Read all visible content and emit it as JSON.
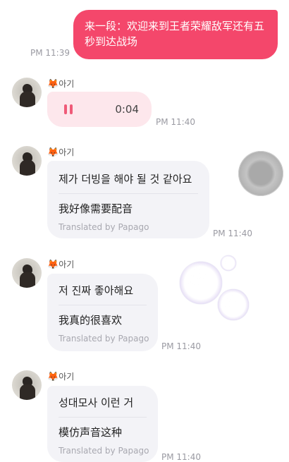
{
  "messages": {
    "sent": {
      "text": "来一段：欢迎来到王者荣耀敌军还有五秒到达战场",
      "time": "PM 11:39"
    },
    "voice": {
      "sender": "아기",
      "sender_emoji": "🦊",
      "duration": "0:04",
      "time": "PM 11:40"
    },
    "text_messages": [
      {
        "sender": "아기",
        "sender_emoji": "🦊",
        "original": "제가 더빙을 해야 될 것 같아요",
        "translation": "我好像需要配音",
        "credit": "Translated by Papago",
        "time": "PM 11:40"
      },
      {
        "sender": "아기",
        "sender_emoji": "🦊",
        "original": "저 진짜 좋아해요",
        "translation": "我真的很喜欢",
        "credit": "Translated by Papago",
        "time": "PM 11:40"
      },
      {
        "sender": "아기",
        "sender_emoji": "🦊",
        "original": "성대모사 이런 거",
        "translation": "模仿声音这种",
        "credit": "Translated by Papago",
        "time": "PM 11:40"
      }
    ]
  },
  "colors": {
    "sent_bubble": "#f4476b",
    "voice_bubble": "#fde7ec",
    "received_bubble": "#f3f3f7",
    "pause_icon": "#ef5a78"
  },
  "icons": [
    "avatar",
    "fox-emoji",
    "pause-icon",
    "gray-circle-decoration",
    "soap-bubble-sticker"
  ]
}
